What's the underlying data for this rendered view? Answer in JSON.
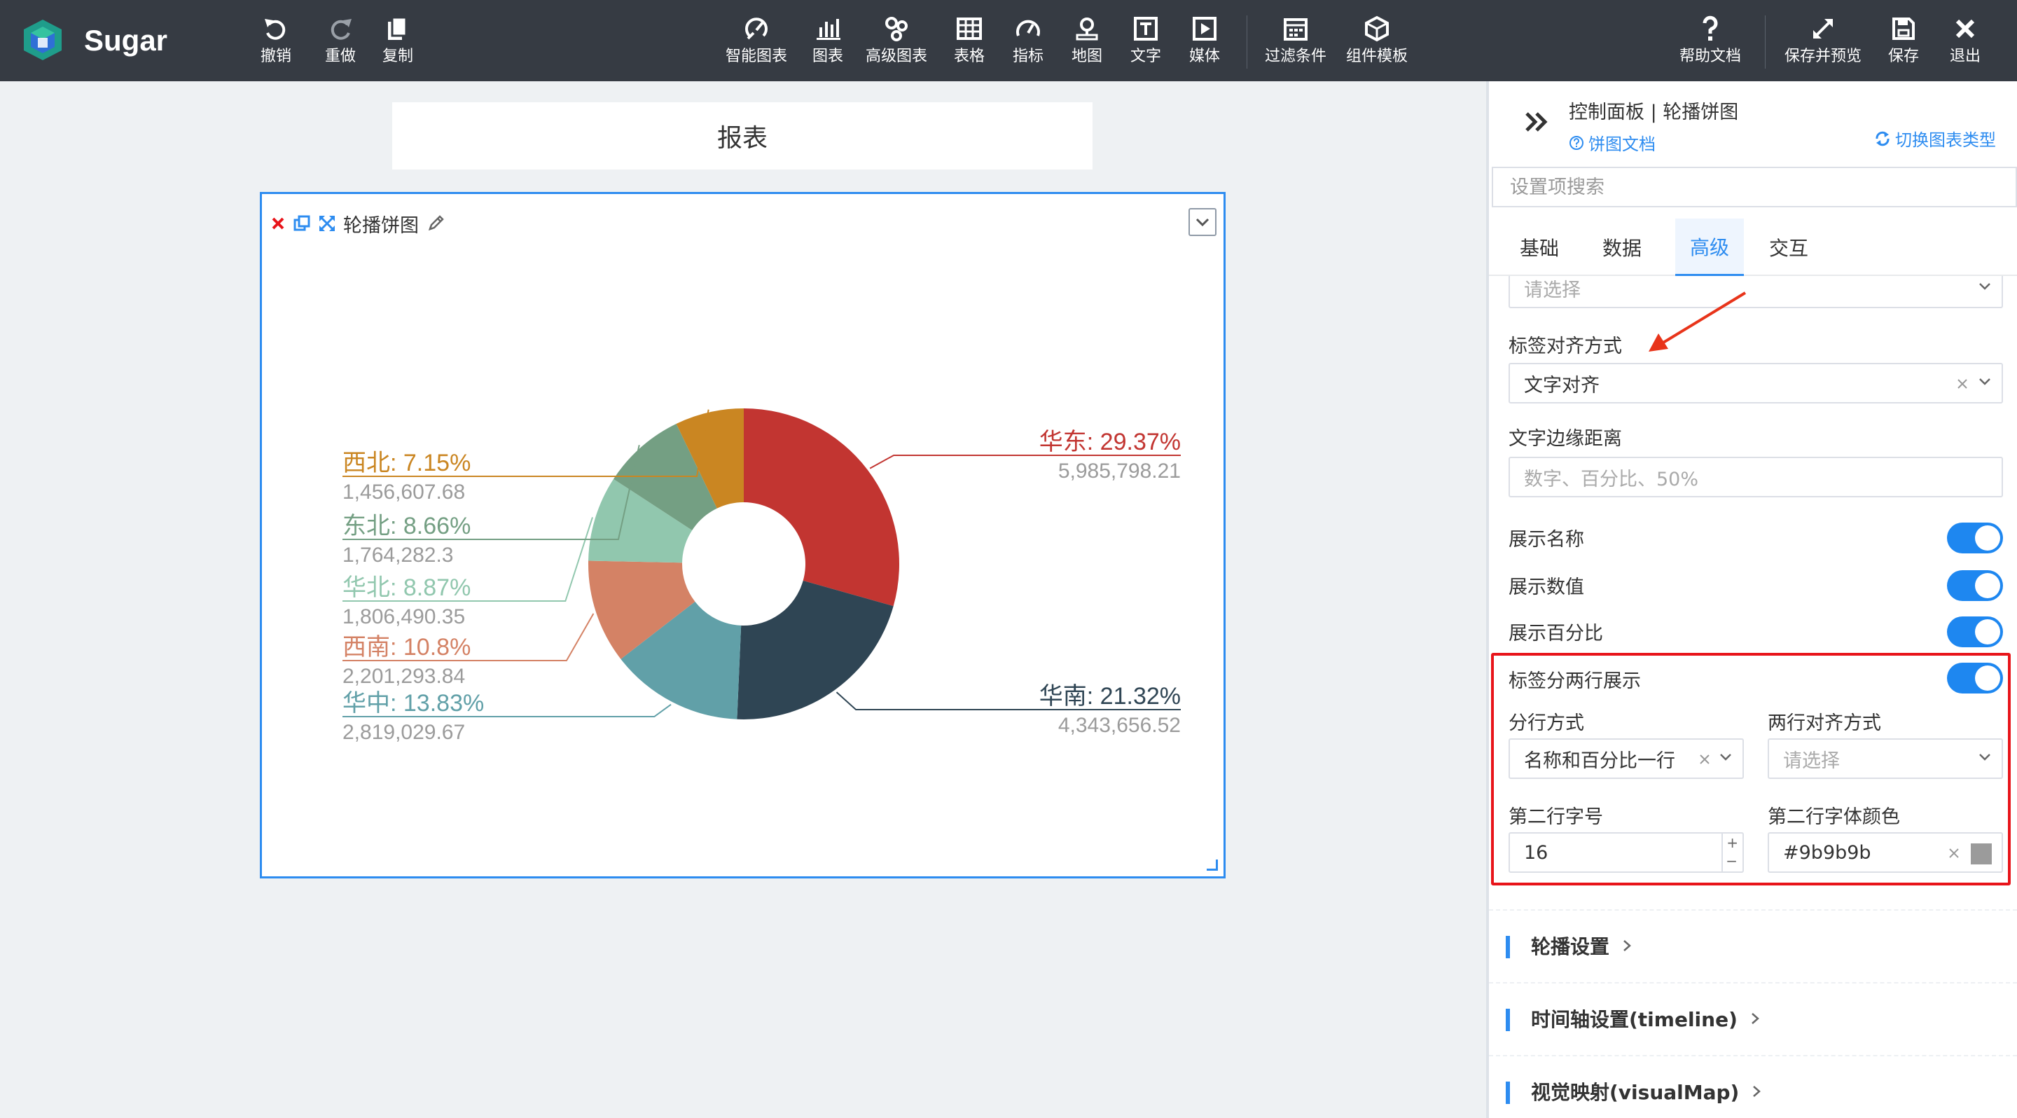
{
  "app": {
    "name": "Sugar"
  },
  "toolbar": {
    "left": [
      {
        "id": "undo",
        "label": "撤销",
        "icon": "undo-icon"
      },
      {
        "id": "redo",
        "label": "重做",
        "icon": "redo-icon"
      },
      {
        "id": "copy",
        "label": "复制",
        "icon": "copy-icon"
      }
    ],
    "center": [
      {
        "id": "smart-chart",
        "label": "智能图表"
      },
      {
        "id": "chart",
        "label": "图表"
      },
      {
        "id": "advanced-chart",
        "label": "高级图表"
      },
      {
        "id": "table",
        "label": "表格"
      },
      {
        "id": "metric",
        "label": "指标"
      },
      {
        "id": "map",
        "label": "地图"
      },
      {
        "id": "text",
        "label": "文字"
      },
      {
        "id": "media",
        "label": "媒体"
      },
      {
        "id": "filter",
        "label": "过滤条件"
      },
      {
        "id": "component-template",
        "label": "组件模板"
      }
    ],
    "right": [
      {
        "id": "help-docs",
        "label": "帮助文档"
      },
      {
        "id": "save-preview",
        "label": "保存并预览"
      },
      {
        "id": "save",
        "label": "保存"
      },
      {
        "id": "exit",
        "label": "退出"
      }
    ]
  },
  "report": {
    "title": "报表"
  },
  "card": {
    "title": "轮播饼图"
  },
  "chart_data": {
    "type": "pie",
    "donut": true,
    "slices": [
      {
        "name": "华东",
        "percent": "29.37%",
        "value": "5,985,798.21",
        "share": 29.37,
        "color": "#c23531",
        "side": "right"
      },
      {
        "name": "华南",
        "percent": "21.32%",
        "value": "4,343,656.52",
        "share": 21.32,
        "color": "#2f4554",
        "side": "right"
      },
      {
        "name": "华中",
        "percent": "13.83%",
        "value": "2,819,029.67",
        "share": 13.83,
        "color": "#61a0a8",
        "side": "left"
      },
      {
        "name": "西南",
        "percent": "10.8%",
        "value": "2,201,293.84",
        "share": 10.8,
        "color": "#d48265",
        "side": "left"
      },
      {
        "name": "华北",
        "percent": "8.87%",
        "value": "1,806,490.35",
        "share": 8.87,
        "color": "#91c7ae",
        "side": "left"
      },
      {
        "name": "东北",
        "percent": "8.66%",
        "value": "1,764,282.3",
        "share": 8.66,
        "color": "#749f83",
        "side": "left"
      },
      {
        "name": "西北",
        "percent": "7.15%",
        "value": "1,456,607.68",
        "share": 7.15,
        "color": "#ca8622",
        "side": "left"
      }
    ],
    "second_line_color": "#9b9b9b"
  },
  "panel": {
    "title": "控制面板 | 轮播饼图",
    "doc_link": "饼图文档",
    "switch_type": "切换图表类型",
    "search_placeholder": "设置项搜索",
    "tabs": [
      "基础",
      "数据",
      "高级",
      "交互"
    ],
    "active_tab": "高级",
    "top_select_placeholder": "请选择",
    "label_align": {
      "label": "标签对齐方式",
      "value": "文字对齐"
    },
    "text_margin": {
      "label": "文字边缘距离",
      "placeholder": "数字、百分比、50%"
    },
    "toggles": [
      {
        "label": "展示名称",
        "on": true
      },
      {
        "label": "展示数值",
        "on": true
      },
      {
        "label": "展示百分比",
        "on": true
      }
    ],
    "two_line": {
      "label": "标签分两行展示",
      "on": true,
      "split_mode": {
        "label": "分行方式",
        "value": "名称和百分比一行"
      },
      "align_mode": {
        "label": "两行对齐方式",
        "placeholder": "请选择"
      },
      "font_size": {
        "label": "第二行字号",
        "value": "16"
      },
      "font_color": {
        "label": "第二行字体颜色",
        "value": "#9b9b9b"
      }
    },
    "sections": [
      "轮播设置",
      "时间轴设置(timeline)",
      "视觉映射(visualMap)"
    ]
  },
  "colors": {
    "accent": "#2d8cf0",
    "toolbar": "#363b43",
    "highlight": "#e8141a",
    "toggle": "#1e87f0"
  }
}
